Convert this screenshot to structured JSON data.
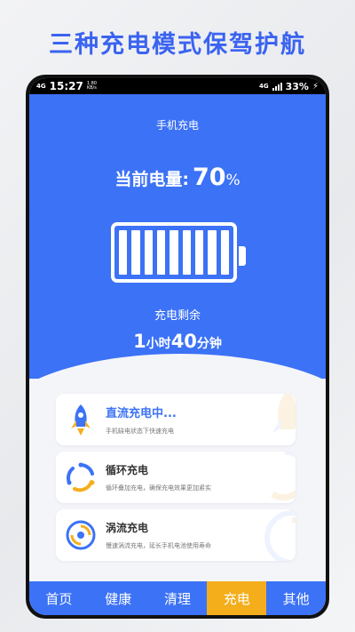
{
  "promo": {
    "title": "三种充电模式保驾护航"
  },
  "status_bar": {
    "network_tag": "4G",
    "time": "15:27",
    "speed_value": "1.80",
    "speed_unit": "KB/s",
    "right_network_tag": "4G",
    "battery_percent": "33%",
    "charging_icon": "bolt-icon"
  },
  "hero": {
    "subtitle": "手机充电",
    "level_label": "当前电量:",
    "level_value": "70",
    "level_unit": "%",
    "battery_icon": "battery-icon",
    "remain_label": "充电剩余",
    "remain_hours": "1",
    "remain_hours_unit": "小时",
    "remain_minutes": "40",
    "remain_minutes_unit": "分钟"
  },
  "modes": [
    {
      "title": "直流充电中...",
      "desc": "手机缺电状态下快速充电",
      "icon": "rocket-icon",
      "active": true
    },
    {
      "title": "循环充电",
      "desc": "循环叠加充电，确保充电效果更加紧实",
      "icon": "cycle-icon",
      "active": false
    },
    {
      "title": "涡流充电",
      "desc": "慢速涡流充电，延长手机电池使用寿命",
      "icon": "vortex-icon",
      "active": false
    }
  ],
  "tabs": [
    {
      "label": "首页",
      "active": false
    },
    {
      "label": "健康",
      "active": false
    },
    {
      "label": "清理",
      "active": false
    },
    {
      "label": "充电",
      "active": true
    },
    {
      "label": "其他",
      "active": false
    }
  ],
  "colors": {
    "primary": "#3c72f6",
    "accent": "#f4ae1c",
    "title": "#3a63f0"
  }
}
